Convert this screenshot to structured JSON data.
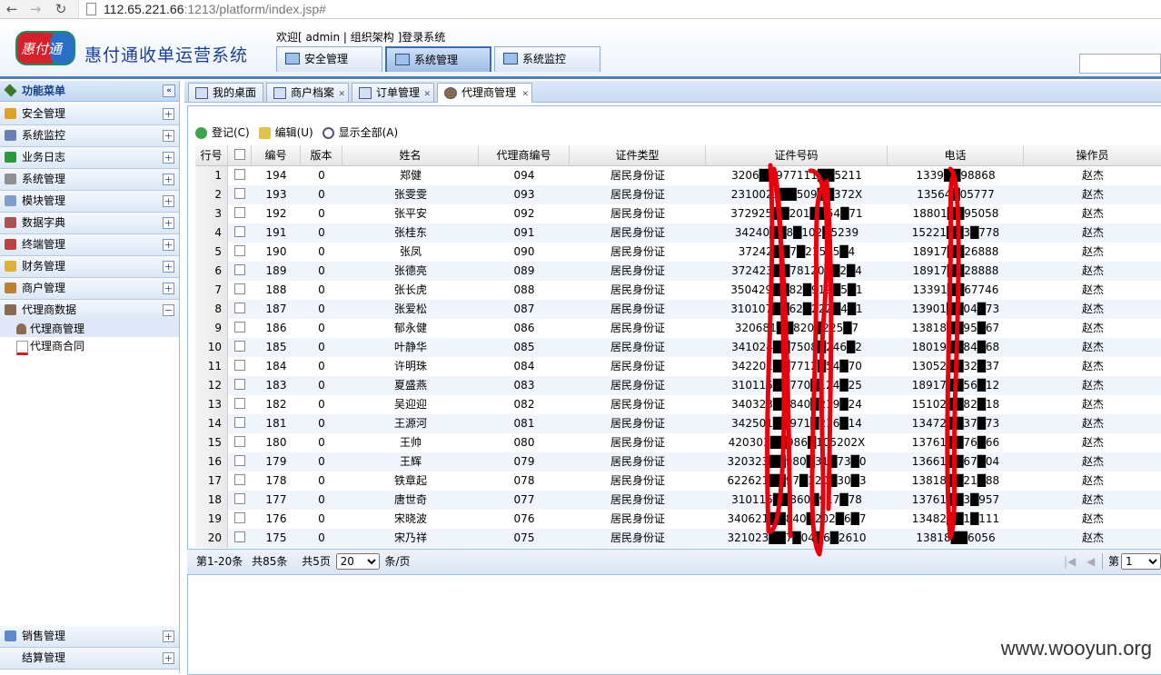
{
  "browser": {
    "url_host": "112.65.221.66",
    "url_rest": ":1213/platform/index.jsp#"
  },
  "header": {
    "logo_text": "惠付通",
    "system_title": "惠付通收单运营系统",
    "welcome": "欢迎[ admin | 组织架构 ]登录系统",
    "tabs": [
      {
        "label": "安全管理"
      },
      {
        "label": "系统管理"
      },
      {
        "label": "系统监控"
      }
    ]
  },
  "sidebar": {
    "title": "功能菜单",
    "items": [
      {
        "label": "安全管理",
        "color": "#e0a020"
      },
      {
        "label": "系统监控",
        "color": "#6a7fb8"
      },
      {
        "label": "业务日志",
        "color": "#2a9a3a"
      },
      {
        "label": "系统管理",
        "color": "#909090"
      },
      {
        "label": "模块管理",
        "color": "#7f9fcf"
      },
      {
        "label": "数据字典",
        "color": "#b05050"
      },
      {
        "label": "终端管理",
        "color": "#c04040"
      },
      {
        "label": "财务管理",
        "color": "#e0b030"
      },
      {
        "label": "商户管理",
        "color": "#c08030"
      },
      {
        "label": "代理商数据",
        "color": "#8a6a50"
      }
    ],
    "sub_items": [
      {
        "label": "代理商管理"
      },
      {
        "label": "代理商合同"
      }
    ],
    "bottom_items": [
      {
        "label": "销售管理",
        "color": "#5a8ad0"
      },
      {
        "label": "结算管理",
        "color": "#ffffff"
      }
    ]
  },
  "tabs": [
    {
      "label": "我的桌面"
    },
    {
      "label": "商户档案"
    },
    {
      "label": "订单管理"
    },
    {
      "label": "代理商管理"
    }
  ],
  "toolbar": {
    "register": "登记(C)",
    "edit": "编辑(U)",
    "show_all": "显示全部(A)"
  },
  "grid": {
    "headers": [
      "行号",
      "编号",
      "版本",
      "姓名",
      "代理商编号",
      "证件类型",
      "证件号码",
      "电话",
      "操作员"
    ],
    "rows": [
      {
        "n": "1",
        "id": "194",
        "ver": "0",
        "name": "郑健",
        "code": "094",
        "type": "居民身份证",
        "cert": "3206██977111██5211",
        "phone": "1339██98868",
        "op": "赵杰"
      },
      {
        "n": "2",
        "id": "193",
        "ver": "0",
        "name": "张雯雯",
        "code": "093",
        "type": "居民身份证",
        "cert": "2310021██509██372X",
        "phone": "13564█05777",
        "op": "赵杰"
      },
      {
        "n": "3",
        "id": "192",
        "ver": "0",
        "name": "张平安",
        "code": "092",
        "type": "居民身份证",
        "cert": "372925██201██54█71",
        "phone": "18801██95058",
        "op": "赵杰"
      },
      {
        "n": "4",
        "id": "191",
        "ver": "0",
        "name": "张桂东",
        "code": "091",
        "type": "居民身份证",
        "cert": "34240██8█102█5239",
        "phone": "15221██3█778",
        "op": "赵杰"
      },
      {
        "n": "5",
        "id": "190",
        "ver": "0",
        "name": "张凤",
        "code": "090",
        "type": "居民身份证",
        "cert": "37242██7█21525█4",
        "phone": "18917██26888",
        "op": "赵杰"
      },
      {
        "n": "6",
        "id": "189",
        "ver": "0",
        "name": "张德亮",
        "code": "089",
        "type": "居民身份证",
        "cert": "372423██781207█2█4",
        "phone": "18917██28888",
        "op": "赵杰"
      },
      {
        "n": "7",
        "id": "188",
        "ver": "0",
        "name": "张长虎",
        "code": "088",
        "type": "居民身份证",
        "cert": "350429██82█919█5█1",
        "phone": "13391██67746",
        "op": "赵杰"
      },
      {
        "n": "8",
        "id": "187",
        "ver": "0",
        "name": "张爱松",
        "code": "087",
        "type": "居民身份证",
        "cert": "310107██62█222█4█1",
        "phone": "13901██04█73",
        "op": "赵杰"
      },
      {
        "n": "9",
        "id": "186",
        "ver": "0",
        "name": "郁永健",
        "code": "086",
        "type": "居民身份证",
        "cert": "320681██820█225█7",
        "phone": "13818██95█67",
        "op": "赵杰"
      },
      {
        "n": "10",
        "id": "185",
        "ver": "0",
        "name": "叶静华",
        "code": "085",
        "type": "居民身份证",
        "cert": "341024██7508█246█2",
        "phone": "18019██84█68",
        "op": "赵杰"
      },
      {
        "n": "11",
        "id": "184",
        "ver": "0",
        "name": "许明珠",
        "code": "084",
        "type": "居民身份证",
        "cert": "342201██7712█54█70",
        "phone": "13052██32█37",
        "op": "赵杰"
      },
      {
        "n": "12",
        "id": "183",
        "ver": "0",
        "name": "夏盛燕",
        "code": "083",
        "type": "居民身份证",
        "cert": "310115██770█124█25",
        "phone": "18917██56█12",
        "op": "赵杰"
      },
      {
        "n": "13",
        "id": "182",
        "ver": "0",
        "name": "吴迎迎",
        "code": "082",
        "type": "居民身份证",
        "cert": "340323██840█219█24",
        "phone": "15102██82█18",
        "op": "赵杰"
      },
      {
        "n": "14",
        "id": "181",
        "ver": "0",
        "name": "王源河",
        "code": "081",
        "type": "居民身份证",
        "cert": "342501██971█216█14",
        "phone": "13472██37█73",
        "op": "赵杰"
      },
      {
        "n": "15",
        "id": "180",
        "ver": "0",
        "name": "王帅",
        "code": "080",
        "type": "居民身份证",
        "cert": "420303██986█105202X",
        "phone": "13761██76█66",
        "op": "赵杰"
      },
      {
        "n": "16",
        "id": "179",
        "ver": "0",
        "name": "王辉",
        "code": "079",
        "type": "居民身份证",
        "cert": "320323██980█31█73█0",
        "phone": "13661██67█04",
        "op": "赵杰"
      },
      {
        "n": "17",
        "id": "178",
        "ver": "0",
        "name": "铁章起",
        "code": "078",
        "type": "居民身份证",
        "cert": "622621██97█120█30█3",
        "phone": "13818██21█88",
        "op": "赵杰"
      },
      {
        "n": "18",
        "id": "177",
        "ver": "0",
        "name": "唐世奇",
        "code": "077",
        "type": "居民身份证",
        "cert": "310115██860█917█78",
        "phone": "13761██3█957",
        "op": "赵杰"
      },
      {
        "n": "19",
        "id": "176",
        "ver": "0",
        "name": "宋晓波",
        "code": "076",
        "type": "居民身份证",
        "cert": "340621██840█202█6█7",
        "phone": "13482██1█111",
        "op": "赵杰"
      },
      {
        "n": "20",
        "id": "175",
        "ver": "0",
        "name": "宋乃祥",
        "code": "075",
        "type": "居民身份证",
        "cert": "321023██7█04█6█2610",
        "phone": "13818██6056",
        "op": "赵杰"
      }
    ]
  },
  "pager": {
    "range": "第1-20条",
    "total": "共85条",
    "pages": "共5页",
    "page_size": "20",
    "per_page_unit": "条/页",
    "page_label": "第",
    "current_page": "1"
  },
  "watermark": "www.wooyun.org",
  "colors": {
    "accent": "#4d7fc2",
    "header_text": "#15428b",
    "row_alt": "#f0f4fb",
    "scribble": "#e8000c"
  }
}
